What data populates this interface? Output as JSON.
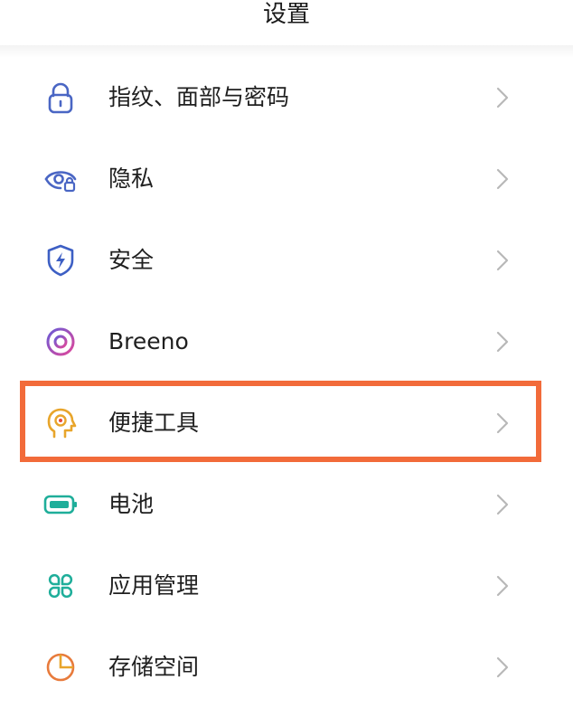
{
  "header": {
    "title": "设置"
  },
  "settings": {
    "items": [
      {
        "label": "指纹、面部与密码",
        "icon": "lock-icon",
        "color": "#4a66c4"
      },
      {
        "label": "隐私",
        "icon": "privacy-eye-icon",
        "color": "#4a66c4"
      },
      {
        "label": "安全",
        "icon": "shield-icon",
        "color": "#3d5fc4"
      },
      {
        "label": "Breeno",
        "icon": "breeno-ring-icon",
        "color": "#b84fc2"
      },
      {
        "label": "便捷工具",
        "icon": "head-gear-icon",
        "color": "#e8a52b"
      },
      {
        "label": "电池",
        "icon": "battery-icon",
        "color": "#1fae9a"
      },
      {
        "label": "应用管理",
        "icon": "apps-grid-icon",
        "color": "#1fae9a"
      },
      {
        "label": "存储空间",
        "icon": "storage-pie-icon",
        "color": "#e87b3c"
      }
    ]
  },
  "highlight": {
    "target": "便捷工具",
    "color": "#f26b3a"
  }
}
